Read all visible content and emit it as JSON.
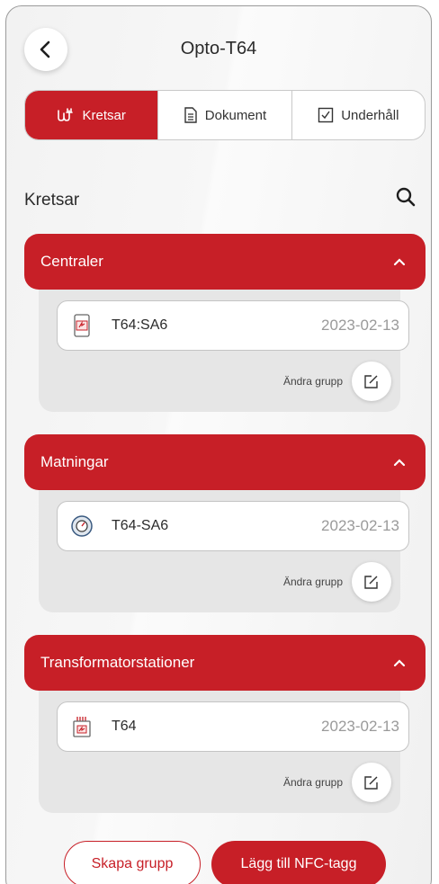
{
  "header": {
    "title": "Opto-T64",
    "back_icon": "chevron-left-icon"
  },
  "tabs": [
    {
      "label": "Kretsar",
      "icon": "circuit-icon",
      "active": true
    },
    {
      "label": "Dokument",
      "icon": "document-icon",
      "active": false
    },
    {
      "label": "Underhåll",
      "icon": "checkbox-icon",
      "active": false
    }
  ],
  "section": {
    "title": "Kretsar",
    "search_icon": "search-icon"
  },
  "groups": [
    {
      "name": "Centraler",
      "item": {
        "icon": "panel-icon",
        "name": "T64:SA6",
        "date": "2023-02-13"
      },
      "edit_label": "Ändra grupp"
    },
    {
      "name": "Matningar",
      "item": {
        "icon": "meter-icon",
        "name": "T64-SA6",
        "date": "2023-02-13"
      },
      "edit_label": "Ändra grupp"
    },
    {
      "name": "Transformatorstationer",
      "item": {
        "icon": "transformer-icon",
        "name": "T64",
        "date": "2023-02-13"
      },
      "edit_label": "Ändra grupp"
    }
  ],
  "footer": {
    "create_group": "Skapa grupp",
    "add_nfc": "Lägg till NFC-tagg"
  },
  "colors": {
    "accent": "#c71f27",
    "background": "#f2f2f2"
  }
}
